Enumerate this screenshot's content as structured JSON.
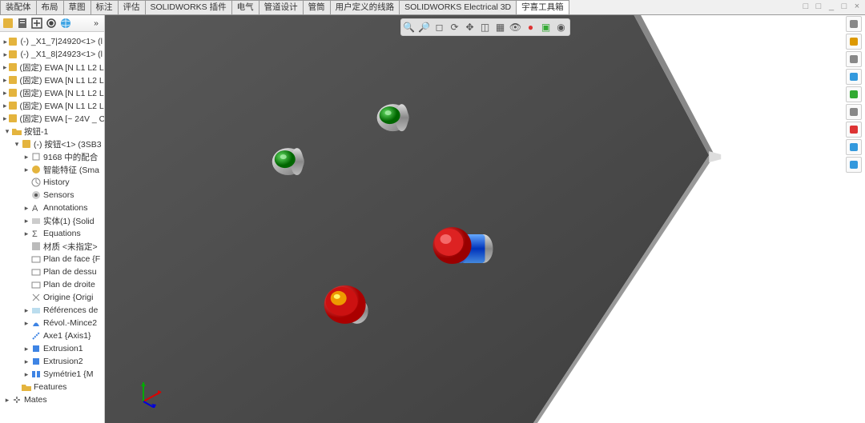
{
  "tabs": [
    "装配体",
    "布局",
    "草图",
    "标注",
    "评估",
    "SOLIDWORKS 插件",
    "电气",
    "管道设计",
    "管筒",
    "用户定义的线路",
    "SOLIDWORKS Electrical 3D",
    "宇喜工具箱"
  ],
  "activeTab": 11,
  "windowControls": {
    "collapse": "□",
    "expand": "□",
    "min": "_",
    "max": "□",
    "close": "×"
  },
  "leftToolbar": [
    "config",
    "filter",
    "expand",
    "display",
    "globe",
    "hide"
  ],
  "sideToolbarIcons": [
    "home",
    "rebuild",
    "cut",
    "appearance",
    "texture",
    "section",
    "scene",
    "web",
    "help"
  ],
  "viewportToolbarIcons": [
    "zoom-fit",
    "zoom",
    "zoom-area",
    "rotate",
    "pan",
    "section",
    "display",
    "hide",
    "appearance",
    "scene",
    "render"
  ],
  "tree": [
    {
      "ind": 0,
      "exp": "▸",
      "icon": "asm",
      "label": "(-) _X1_7|24920<1> (l"
    },
    {
      "ind": 0,
      "exp": "▸",
      "icon": "asm",
      "label": "(-) _X1_8|24923<1> (l"
    },
    {
      "ind": 0,
      "exp": "▸",
      "icon": "asm",
      "label": "(固定) EWA [N L1 L2 L"
    },
    {
      "ind": 0,
      "exp": "▸",
      "icon": "asm",
      "label": "(固定) EWA [N L1 L2 L"
    },
    {
      "ind": 0,
      "exp": "▸",
      "icon": "asm",
      "label": "(固定) EWA [N L1 L2 L"
    },
    {
      "ind": 0,
      "exp": "▸",
      "icon": "asm",
      "label": "(固定) EWA [N L1 L2 L"
    },
    {
      "ind": 0,
      "exp": "▸",
      "icon": "asm",
      "label": "(固定) EWA [~ 24V _ C"
    },
    {
      "ind": 0,
      "exp": "▾",
      "icon": "folder",
      "label": "按钮-1"
    },
    {
      "ind": 1,
      "exp": "▾",
      "icon": "asm",
      "label": "(-) 按钮<1> (3SB3"
    },
    {
      "ind": 2,
      "exp": "▸",
      "icon": "mate",
      "label": "9168 中的配合"
    },
    {
      "ind": 2,
      "exp": "▸",
      "icon": "smart",
      "label": "智能特征 (Sma"
    },
    {
      "ind": 2,
      "exp": "",
      "icon": "hist",
      "label": "History"
    },
    {
      "ind": 2,
      "exp": "",
      "icon": "sensor",
      "label": "Sensors"
    },
    {
      "ind": 2,
      "exp": "▸",
      "icon": "ann",
      "label": "Annotations"
    },
    {
      "ind": 2,
      "exp": "▸",
      "icon": "body",
      "label": "实体(1) {Solid"
    },
    {
      "ind": 2,
      "exp": "▸",
      "icon": "eq",
      "label": "Equations"
    },
    {
      "ind": 2,
      "exp": "",
      "icon": "mat",
      "label": "材质 <未指定>"
    },
    {
      "ind": 2,
      "exp": "",
      "icon": "plane",
      "label": "Plan de face {F"
    },
    {
      "ind": 2,
      "exp": "",
      "icon": "plane",
      "label": "Plan de dessu"
    },
    {
      "ind": 2,
      "exp": "",
      "icon": "plane",
      "label": "Plan de droite"
    },
    {
      "ind": 2,
      "exp": "",
      "icon": "orig",
      "label": "Origine {Origi"
    },
    {
      "ind": 2,
      "exp": "▸",
      "icon": "ref",
      "label": "Références de"
    },
    {
      "ind": 2,
      "exp": "▸",
      "icon": "rev",
      "label": "Révol.-Mince2"
    },
    {
      "ind": 2,
      "exp": "",
      "icon": "axis",
      "label": "Axe1 {Axis1}"
    },
    {
      "ind": 2,
      "exp": "▸",
      "icon": "ext",
      "label": "Extrusion1"
    },
    {
      "ind": 2,
      "exp": "▸",
      "icon": "ext",
      "label": "Extrusion2"
    },
    {
      "ind": 2,
      "exp": "▸",
      "icon": "sym",
      "label": "Symétrie1 {M"
    },
    {
      "ind": 1,
      "exp": "",
      "icon": "folder",
      "label": "Features"
    },
    {
      "ind": 0,
      "exp": "▸",
      "icon": "mates",
      "label": "Mates"
    }
  ],
  "axisLabels": {
    "x": "X",
    "y": "Y",
    "z": "Z"
  }
}
